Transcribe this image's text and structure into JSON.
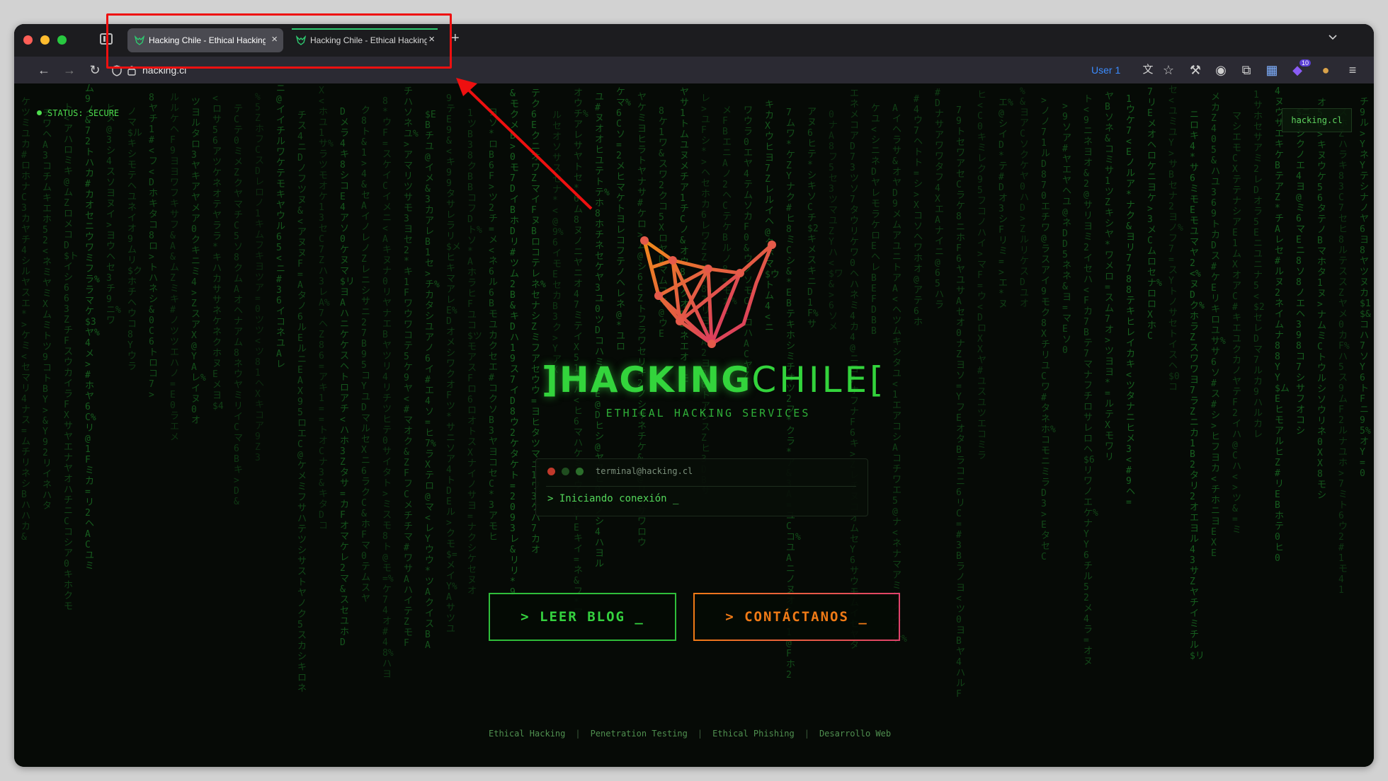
{
  "browser": {
    "tabs": [
      {
        "title": "Hacking Chile - Ethical Hacking",
        "active": true
      },
      {
        "title": "Hacking Chile - Ethical Hacking",
        "active": false
      }
    ],
    "new_tab_label": "+",
    "close_label": "×",
    "url": "hacking.cl",
    "user_badge": "User 1",
    "extension_badge": "10",
    "accent_color": "#2ecc71"
  },
  "page": {
    "status_label": "STATUS:",
    "status_value": "SECURE",
    "corner_tag": "hacking.cl",
    "brand_bold": "]HACKING",
    "brand_light": "CHILE[",
    "tagline": "ETHICAL HACKING SERVICES",
    "terminal": {
      "title": "terminal@hacking.cl",
      "text": "> Iniciando conexión _"
    },
    "buttons": {
      "blog": "> LEER BLOG _",
      "contact": "> CONTÁCTANOS _"
    },
    "footer_links": [
      "Ethical Hacking",
      "Penetration Testing",
      "Ethical Phishing",
      "Desarrollo Web"
    ],
    "colors": {
      "primary_green": "#33d43c",
      "orange": "#f07a16",
      "magenta": "#e0426b"
    }
  },
  "annotation": {
    "color": "#ee1010"
  }
}
